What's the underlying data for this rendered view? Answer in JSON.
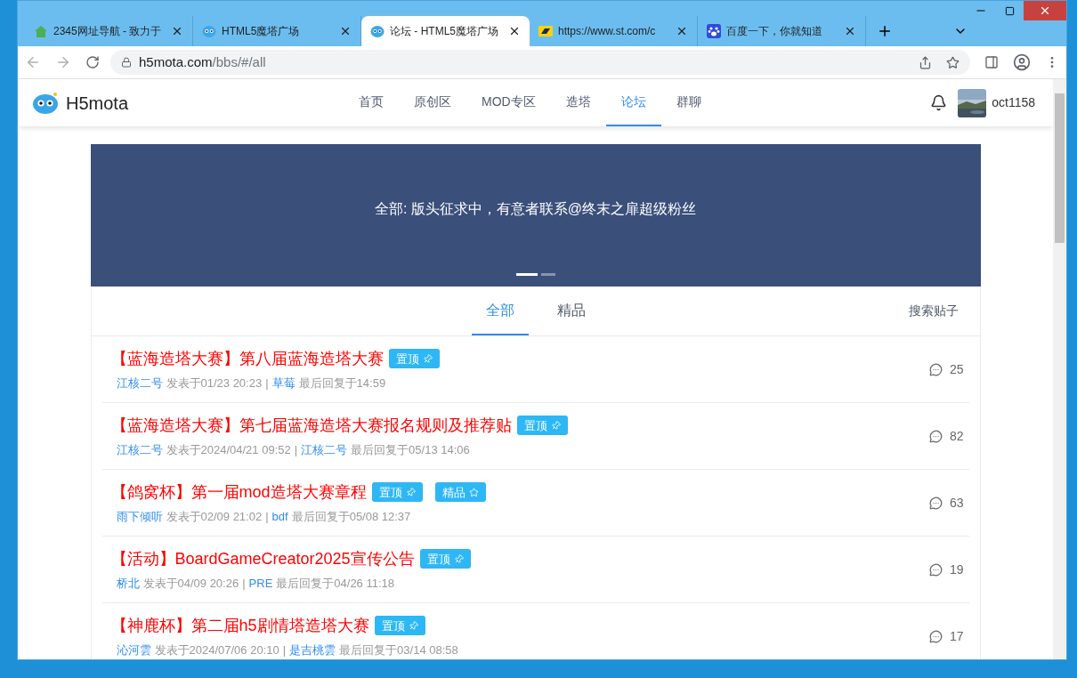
{
  "browser": {
    "tabs": [
      {
        "title": "2345网址导航 - 致力于",
        "kind": "house",
        "selected": false
      },
      {
        "title": "HTML5魔塔广场",
        "kind": "mota",
        "selected": false
      },
      {
        "title": "论坛 - HTML5魔塔广场",
        "kind": "mota",
        "selected": true
      },
      {
        "title": "https://www.st.com/c",
        "kind": "st",
        "selected": false
      },
      {
        "title": "百度一下，你就知道",
        "kind": "paw",
        "selected": false
      }
    ],
    "url_host": "h5mota.com",
    "url_path": "/bbs/#/all"
  },
  "site": {
    "logo": "H5mota",
    "nav": [
      {
        "label": "首页",
        "selected": false
      },
      {
        "label": "原创区",
        "selected": false
      },
      {
        "label": "MOD专区",
        "selected": false
      },
      {
        "label": "造塔",
        "selected": false
      },
      {
        "label": "论坛",
        "selected": true
      },
      {
        "label": "群聊",
        "selected": false
      }
    ],
    "username": "oct1158"
  },
  "banner": {
    "text": "全部: 版头征求中，有意者联系@终末之扉超级粉丝",
    "dots": [
      {
        "selected": true
      },
      {
        "selected": false
      }
    ]
  },
  "forum_tabs": [
    {
      "label": "全部",
      "selected": true
    },
    {
      "label": "精品",
      "selected": false
    }
  ],
  "search_link": "搜索贴子",
  "posts": [
    {
      "title": "【蓝海造塔大赛】第八届蓝海造塔大赛",
      "badges": [
        {
          "kind": "pinned",
          "label": "置顶"
        }
      ],
      "author": "江核二号",
      "posted": "发表于01/23 20:23",
      "separator": "|",
      "last_replier": "草莓",
      "last_reply": "最后回复于14:59",
      "comments": "25"
    },
    {
      "title": "【蓝海造塔大赛】第七届蓝海造塔大赛报名规则及推荐贴",
      "badges": [
        {
          "kind": "pinned",
          "label": "置顶"
        }
      ],
      "author": "江核二号",
      "posted": "发表于2024/04/21 09:52",
      "separator": "|",
      "last_replier": "江核二号",
      "last_reply": "最后回复于05/13 14:06",
      "comments": "82"
    },
    {
      "title": "【鸽窝杯】第一届mod造塔大赛章程",
      "badges": [
        {
          "kind": "pinned",
          "label": "置顶"
        },
        {
          "kind": "featured",
          "label": "精品"
        }
      ],
      "author": "雨下倾听",
      "posted": "发表于02/09 21:02",
      "separator": "|",
      "last_replier": "bdf",
      "last_reply": "最后回复于05/08 12:37",
      "comments": "63"
    },
    {
      "title": "【活动】BoardGameCreator2025宣传公告",
      "badges": [
        {
          "kind": "pinned",
          "label": "置顶"
        }
      ],
      "author": "桥北",
      "posted": "发表于04/09 20:26",
      "separator": "|",
      "last_replier": "PRE",
      "last_reply": "最后回复于04/26 11:18",
      "comments": "19"
    },
    {
      "title": "【神鹿杯】第二届h5剧情塔造塔大赛",
      "badges": [
        {
          "kind": "pinned",
          "label": "置顶"
        }
      ],
      "author": "沁河雲",
      "posted": "发表于2024/07/06 20:10",
      "separator": "|",
      "last_replier": "是吉桃雲",
      "last_reply": "最后回复于03/14 08:58",
      "comments": "17"
    }
  ]
}
